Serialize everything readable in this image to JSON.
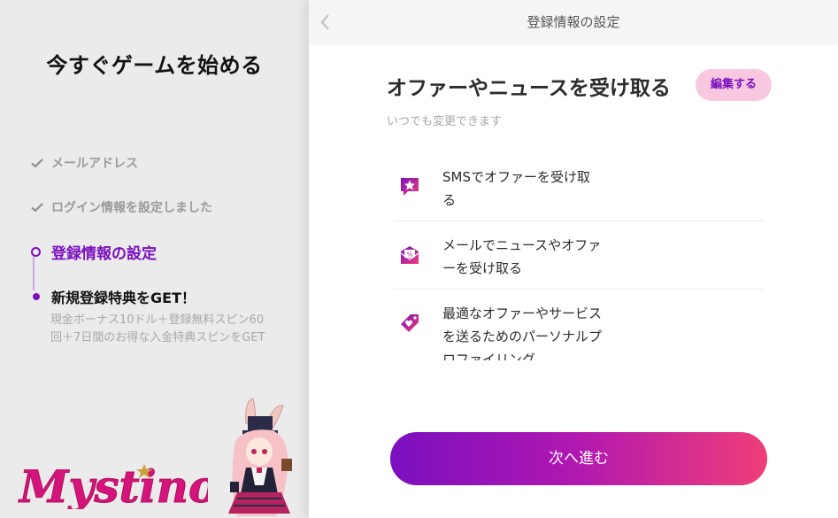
{
  "left": {
    "title": "今すぐゲームを始める",
    "steps": [
      {
        "label": "メールアドレス",
        "state": "done"
      },
      {
        "label": "ログイン情報を設定しました",
        "state": "done"
      },
      {
        "label": "登録情報の設定",
        "state": "current"
      },
      {
        "label": "新規登録特典をGET！",
        "state": "upcoming",
        "description": "現金ボーナス10ドル＋登録無料スピン60回＋7日間のお得な入金特典スピンをGET"
      }
    ],
    "logo_text": "Mystino"
  },
  "header": {
    "title": "登録情報の設定",
    "back_icon": "chevron-left-icon"
  },
  "main": {
    "heading": "オファーやニュースを受け取る",
    "edit_label": "編集する",
    "subtitle": "いつでも変更できます",
    "options": [
      {
        "label": "SMSでオファーを受け取る",
        "icon": "sms-star-icon"
      },
      {
        "label": "メールでニュースやオファーを受け取る",
        "icon": "mail-offer-icon"
      },
      {
        "label": "最適なオファーやサービスを送るためのパーソナルプロファイリング",
        "icon": "tag-heart-icon"
      }
    ],
    "next_label": "次へ進む"
  },
  "colors": {
    "accent": "#7a0fbf",
    "pink": "#f03e78",
    "edit_bg": "#f8c8e0",
    "brand": "#d4147a"
  }
}
